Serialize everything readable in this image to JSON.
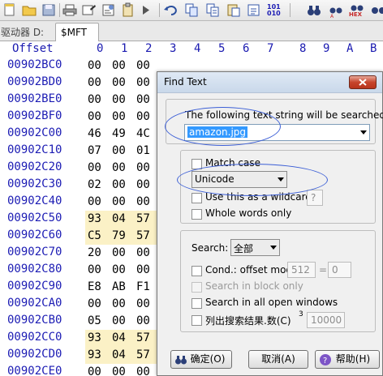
{
  "toolbar": {
    "text_icons": [
      "101\n010",
      "HEX"
    ]
  },
  "tabs": {
    "inactive_label": "驱动器 D:",
    "active_label": "$MFT"
  },
  "hex_header": {
    "offset_label": "Offset",
    "columns": [
      "0",
      "1",
      "2",
      "3",
      "4",
      "5",
      "6",
      "7",
      "8",
      "9",
      "A",
      "B"
    ]
  },
  "hex_rows": [
    {
      "offset": "00902BC0",
      "c0": "00",
      "c1": "00",
      "c2": "00"
    },
    {
      "offset": "00902BD0",
      "c0": "00",
      "c1": "00",
      "c2": "00"
    },
    {
      "offset": "00902BE0",
      "c0": "00",
      "c1": "00",
      "c2": "00"
    },
    {
      "offset": "00902BF0",
      "c0": "00",
      "c1": "00",
      "c2": "00"
    },
    {
      "offset": "00902C00",
      "c0": "46",
      "c1": "49",
      "c2": "4C"
    },
    {
      "offset": "00902C10",
      "c0": "07",
      "c1": "00",
      "c2": "01"
    },
    {
      "offset": "00902C20",
      "c0": "00",
      "c1": "00",
      "c2": "00"
    },
    {
      "offset": "00902C30",
      "c0": "02",
      "c1": "00",
      "c2": "00"
    },
    {
      "offset": "00902C40",
      "c0": "00",
      "c1": "00",
      "c2": "00"
    },
    {
      "offset": "00902C50",
      "c0": "93",
      "c1": "04",
      "c2": "57"
    },
    {
      "offset": "00902C60",
      "c0": "C5",
      "c1": "79",
      "c2": "57"
    },
    {
      "offset": "00902C70",
      "c0": "20",
      "c1": "00",
      "c2": "00"
    },
    {
      "offset": "00902C80",
      "c0": "00",
      "c1": "00",
      "c2": "00"
    },
    {
      "offset": "00902C90",
      "c0": "E8",
      "c1": "AB",
      "c2": "F1"
    },
    {
      "offset": "00902CA0",
      "c0": "00",
      "c1": "00",
      "c2": "00"
    },
    {
      "offset": "00902CB0",
      "c0": "05",
      "c1": "00",
      "c2": "00"
    },
    {
      "offset": "00902CC0",
      "c0": "93",
      "c1": "04",
      "c2": "57"
    },
    {
      "offset": "00902CD0",
      "c0": "93",
      "c1": "04",
      "c2": "57"
    },
    {
      "offset": "00902CE0",
      "c0": "00",
      "c1": "00",
      "c2": "00"
    }
  ],
  "dialog": {
    "title": "Find Text",
    "prompt": "The following text string will be searched:",
    "search_value": "amazon.jpg",
    "match_case_label": "Match case",
    "encoding_value": "Unicode",
    "wildcard_label": "Use this as a wildcard:",
    "wildcard_char": "?",
    "whole_words_label": "Whole words only",
    "search_label": "Search:",
    "search_scope_value": "全部",
    "cond_label": "Cond.: offset mod",
    "cond_mod_value": "512",
    "cond_eq": "=",
    "cond_eq_value": "0",
    "block_only_label": "Search in block only",
    "all_windows_label": "Search in all open windows",
    "list_results_label": "列出搜索结果.数(C)",
    "list_results_sup": "3",
    "list_results_value": "10000",
    "ok_label": "确定(O)",
    "cancel_label": "取消(A)",
    "help_label": "帮助(H)"
  },
  "colors": {
    "offset_blue": "#1c1cb4",
    "highlight": "#fbf1c6",
    "annotation_oval": "#3c5fd6",
    "selection": "#3399ff"
  }
}
